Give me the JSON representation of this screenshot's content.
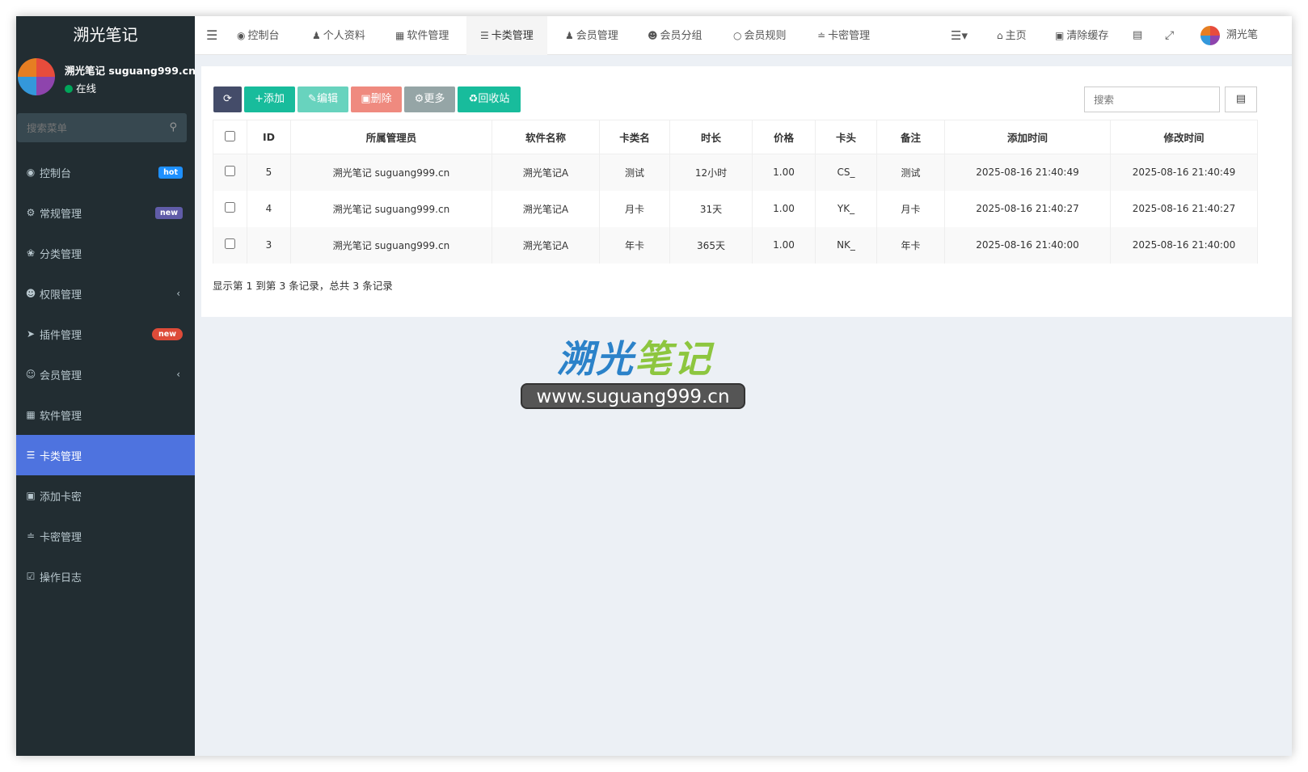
{
  "sidebar": {
    "brand": "溯光笔记",
    "user_name": "溯光笔记 suguang999.cn",
    "user_status": "在线",
    "search_placeholder": "搜索菜单",
    "items": [
      {
        "label": "控制台",
        "icon": "dashboard-icon",
        "badge": "hot"
      },
      {
        "label": "常规管理",
        "icon": "cogs-icon",
        "badge": "new"
      },
      {
        "label": "分类管理",
        "icon": "leaf-icon"
      },
      {
        "label": "权限管理",
        "icon": "group-icon",
        "chevron": "‹"
      },
      {
        "label": "插件管理",
        "icon": "rocket-icon",
        "badge": "new"
      },
      {
        "label": "会员管理",
        "icon": "user-circle-icon",
        "chevron": "‹"
      },
      {
        "label": "软件管理",
        "icon": "grid-icon"
      },
      {
        "label": "卡类管理",
        "icon": "list-icon"
      },
      {
        "label": "添加卡密",
        "icon": "calendar-plus-icon"
      },
      {
        "label": "卡密管理",
        "icon": "rss-icon"
      },
      {
        "label": "操作日志",
        "icon": "check-square-icon"
      }
    ]
  },
  "header": {
    "tabs": [
      {
        "label": "控制台"
      },
      {
        "label": "个人资料"
      },
      {
        "label": "软件管理"
      },
      {
        "label": "卡类管理"
      },
      {
        "label": "会员管理"
      },
      {
        "label": "会员分组"
      },
      {
        "label": "会员规则"
      },
      {
        "label": "卡密管理"
      }
    ],
    "home_label": "主页",
    "clear_cache_label": "清除缓存",
    "user_label": "溯光笔"
  },
  "toolbar": {
    "add": "添加",
    "edit": "编辑",
    "delete": "删除",
    "more": "更多",
    "recycle": "回收站"
  },
  "search_placeholder": "搜索",
  "table": {
    "columns": [
      "ID",
      "所属管理员",
      "软件名称",
      "卡类名",
      "时长",
      "价格",
      "卡头",
      "备注",
      "添加时间",
      "修改时间"
    ],
    "rows": [
      {
        "id": "5",
        "admin": "溯光笔记 suguang999.cn",
        "software": "溯光笔记A",
        "name": "测试",
        "duration": "12小时",
        "price": "1.00",
        "prefix": "CS_",
        "remark": "测试",
        "created": "2025-08-16 21:40:49",
        "updated": "2025-08-16 21:40:49"
      },
      {
        "id": "4",
        "admin": "溯光笔记 suguang999.cn",
        "software": "溯光笔记A",
        "name": "月卡",
        "duration": "31天",
        "price": "1.00",
        "prefix": "YK_",
        "remark": "月卡",
        "created": "2025-08-16 21:40:27",
        "updated": "2025-08-16 21:40:27"
      },
      {
        "id": "3",
        "admin": "溯光笔记 suguang999.cn",
        "software": "溯光笔记A",
        "name": "年卡",
        "duration": "365天",
        "price": "1.00",
        "prefix": "NK_",
        "remark": "年卡",
        "created": "2025-08-16 21:40:00",
        "updated": "2025-08-16 21:40:00"
      }
    ]
  },
  "pager": "显示第 1 到第 3 条记录，总共 3 条记录",
  "watermark": {
    "title_a": "溯光",
    "title_b": "笔记",
    "url": "www.suguang999.cn"
  },
  "colors": {
    "sidebar_bg": "#222d32",
    "active": "#4e73df",
    "success": "#18bc9c",
    "danger": "#e74c3c",
    "muted": "#95a5a6",
    "dark": "#444c69"
  }
}
